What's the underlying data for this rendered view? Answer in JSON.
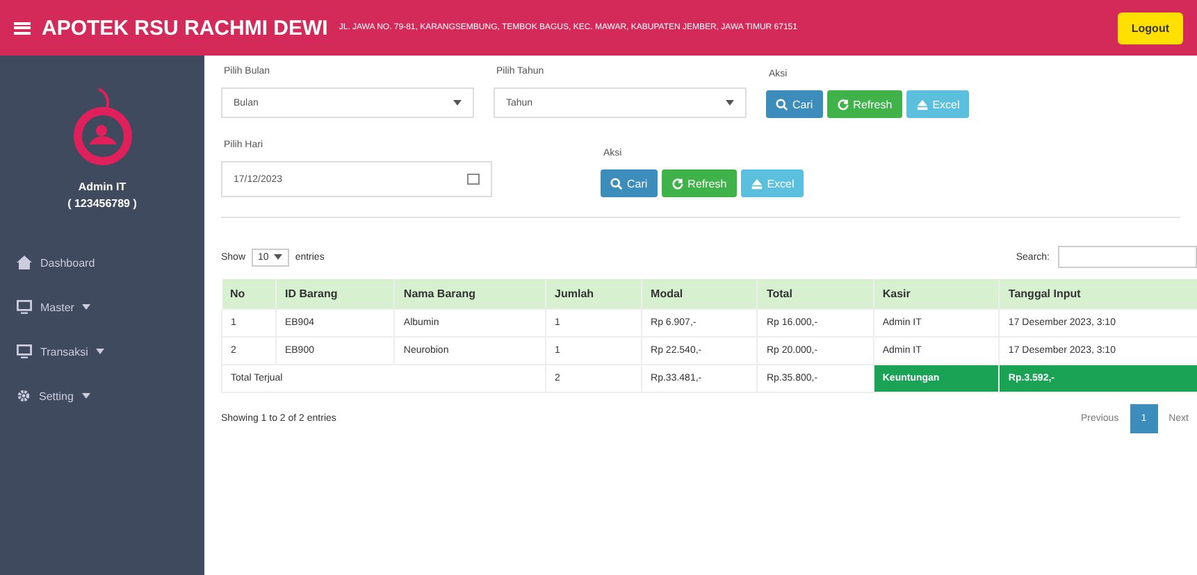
{
  "header": {
    "title": "APOTEK RSU RACHMI DEWI",
    "address": "JL. JAWA NO. 79-81, KARANGSEMBUNG, TEMBOK BAGUS, KEC. MAWAR, KABUPATEN JEMBER, JAWA TIMUR 67151",
    "logout": "Logout"
  },
  "sidebar": {
    "user": "Admin IT",
    "user_id": "( 123456789 )",
    "items": [
      {
        "label": "Dashboard",
        "kind": "home",
        "expandable": false
      },
      {
        "label": "Master",
        "kind": "monitor",
        "expandable": true
      },
      {
        "label": "Transaksi",
        "kind": "monitor",
        "expandable": true
      },
      {
        "label": "Setting",
        "kind": "gear",
        "expandable": true
      }
    ]
  },
  "filter_month": {
    "month_label": "Pilih Bulan",
    "month_value": "Bulan",
    "year_label": "Pilih Tahun",
    "year_value": "Tahun",
    "action_label": "Aksi",
    "buttons": [
      {
        "label": "Cari",
        "kind": "search"
      },
      {
        "label": "Refresh",
        "kind": "refresh"
      },
      {
        "label": "Excel",
        "kind": "excel"
      }
    ]
  },
  "filter_day": {
    "day_label": "Pilih Hari",
    "day_value": "17/12/2023",
    "action_label": "Aksi",
    "buttons": [
      {
        "label": "Cari",
        "kind": "search"
      },
      {
        "label": "Refresh",
        "kind": "refresh"
      },
      {
        "label": "Excel",
        "kind": "excel"
      }
    ]
  },
  "table": {
    "show_label": "Show",
    "page_size": "10",
    "entries_label": "entries",
    "search_label": "Search:",
    "columns": [
      "No",
      "ID Barang",
      "Nama Barang",
      "Jumlah",
      "Modal",
      "Total",
      "Kasir",
      "Tanggal Input"
    ],
    "rows": [
      [
        "1",
        "EB904",
        "Albumin",
        "1",
        "Rp 6.907,-",
        "Rp 16.000,-",
        "Admin IT",
        "17 Desember 2023, 3:10"
      ],
      [
        "2",
        "EB900",
        "Neurobion",
        "1",
        "Rp 22.540,-",
        "Rp 20.000,-",
        "Admin IT",
        "17 Desember 2023, 3:10"
      ]
    ],
    "total": {
      "label": "Total Terjual",
      "jumlah": "2",
      "modal": "Rp.33.481,-",
      "total": "Rp.35.800,-",
      "profit_label": "Keuntungan",
      "profit": "Rp.3.592,-"
    },
    "info": "Showing 1 to 2 of 2 entries",
    "pages": [
      {
        "label": "Previous",
        "kind": "nav",
        "selected": false
      },
      {
        "label": "1",
        "kind": "page",
        "selected": true
      },
      {
        "label": "Next",
        "kind": "nav",
        "selected": false
      }
    ]
  }
}
